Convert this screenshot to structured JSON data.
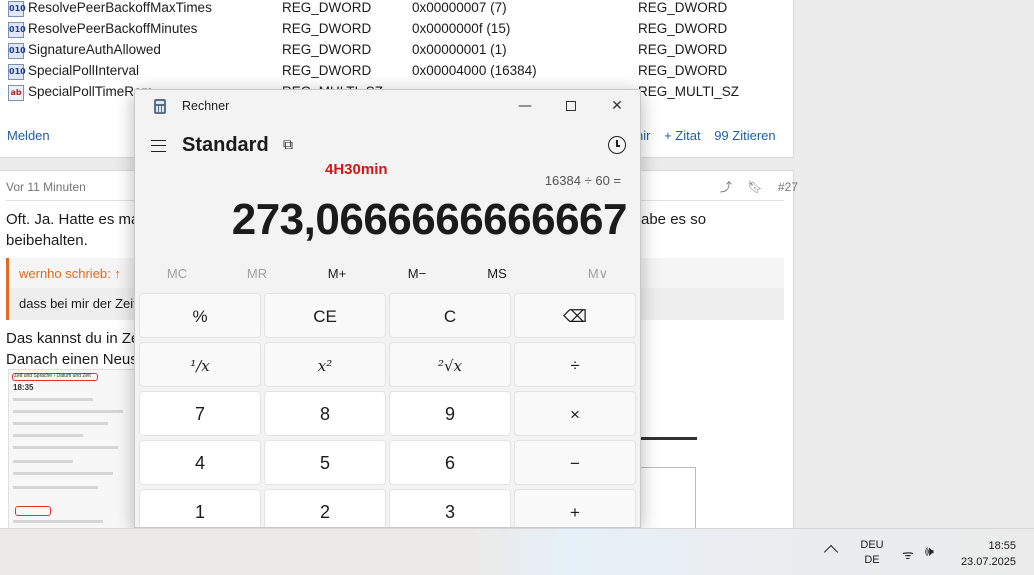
{
  "forum": {
    "registry_rows": [
      {
        "name": "ResolvePeerBackoffMaxTimes",
        "type": "REG_DWORD",
        "value": "0x00000007 (7)",
        "type2": "REG_DWORD",
        "icon": "reg-dword-icon"
      },
      {
        "name": "ResolvePeerBackoffMinutes",
        "type": "REG_DWORD",
        "value": "0x0000000f (15)",
        "type2": "REG_DWORD",
        "icon": "reg-dword-icon"
      },
      {
        "name": "SignatureAuthAllowed",
        "type": "REG_DWORD",
        "value": "0x00000001 (1)",
        "type2": "REG_DWORD",
        "icon": "reg-dword-icon"
      },
      {
        "name": "SpecialPollInterval",
        "type": "REG_DWORD",
        "value": "0x00004000 (16384)",
        "type2": "REG_DWORD",
        "icon": "reg-dword-icon"
      },
      {
        "name": "SpecialPollTimeRem",
        "type": "REG_MULTI_SZ",
        "value": "",
        "type2": "REG_MULTI_SZ",
        "icon": "reg-sz-icon"
      }
    ],
    "report_label": "Melden",
    "reply_label": "nir",
    "quote_label": "+ Zitat",
    "cite_label": "99 Zitieren",
    "post2": {
      "time": "Vor 11 Minuten",
      "share_icon": "share-icon",
      "bookmark_icon": "bookmark-icon",
      "post_number": "#27",
      "line1_left": "Oft. Ja. Hatte es ma",
      "line1_right": "abe es so",
      "line2": "beibehalten.",
      "quote_author": "wernho schrieb: ",
      "quote_icon": "↑",
      "quote_text": "dass bei mir der Zeit",
      "line3": "Das kannst du in Ze",
      "line4": "Danach einen Neus",
      "thumb_title": "Zeit und Sprache › Datum und Zeit",
      "thumb_time": "18:35"
    }
  },
  "calculator": {
    "window_title": "Rechner",
    "minimize_icon": "—",
    "close_icon": "✕",
    "mode": "Standard",
    "keep_on_top_icon": "⧉",
    "annotation": "4H30min",
    "expression": "16384 ÷ 60 =",
    "result": "273,0666666666667",
    "memory": [
      "MC",
      "MR",
      "M+",
      "M−",
      "MS",
      "M∨"
    ],
    "keys": [
      [
        "%",
        "CE",
        "C",
        "⌫"
      ],
      [
        "¹∕x",
        "x²",
        "²√x",
        "÷"
      ],
      [
        "7",
        "8",
        "9",
        "×"
      ],
      [
        "4",
        "5",
        "6",
        "−"
      ],
      [
        "1",
        "2",
        "3",
        "+"
      ]
    ]
  },
  "taskbar": {
    "chevron_icon": "chevron-up-icon",
    "lang_line1": "DEU",
    "lang_line2": "DE",
    "wifi_icon": "ᯤ",
    "volume_icon": "🕪",
    "time": "18:55",
    "date": "23.07.2025"
  }
}
